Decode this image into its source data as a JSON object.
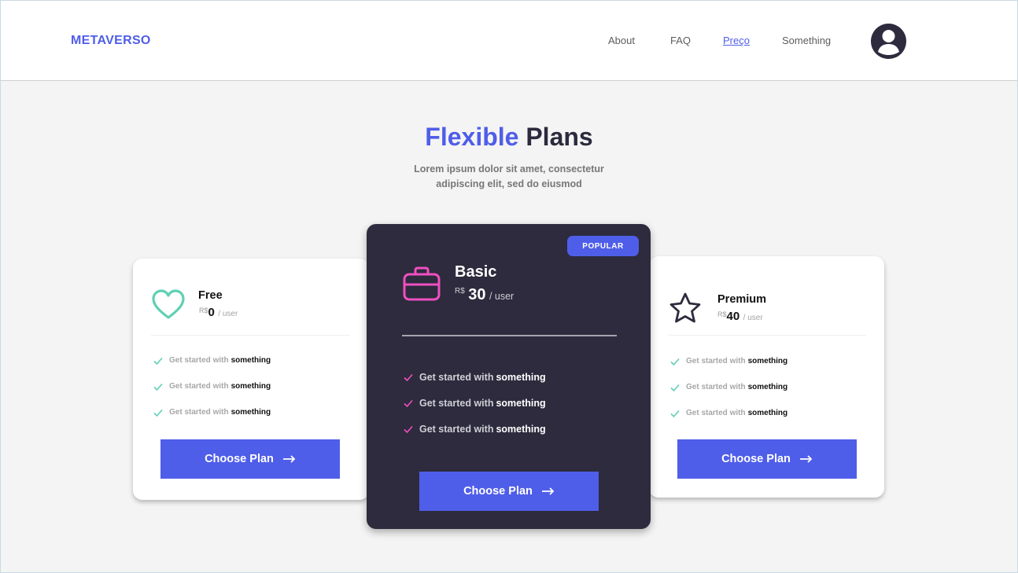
{
  "header": {
    "logo": "METAVERSO",
    "nav": [
      {
        "label": "About",
        "active": false
      },
      {
        "label": "FAQ",
        "active": false
      },
      {
        "label": "Preço",
        "active": true
      },
      {
        "label": "Something",
        "active": false
      }
    ],
    "avatar_icon": "user-icon"
  },
  "hero": {
    "title_accent": "Flexible",
    "title_rest": "Plans",
    "subtitle_line1": "Lorem ipsum dolor sit amet, consectetur",
    "subtitle_line2": "adipiscing elit, sed do eiusmod"
  },
  "plans": [
    {
      "name": "Free",
      "currency": "R$",
      "price": "0",
      "per": "/ user",
      "icon": "heart-icon",
      "features": [
        {
          "text": "Get started with",
          "strong": "something"
        },
        {
          "text": "Get started with",
          "strong": "something"
        },
        {
          "text": "Get started with",
          "strong": "something"
        }
      ],
      "button": "Choose Plan"
    },
    {
      "name": "Basic",
      "badge": "POPULAR",
      "currency": "R$",
      "price": "30",
      "per": "/ user",
      "icon": "briefcase-icon",
      "features": [
        {
          "text": "Get started with",
          "strong": "something"
        },
        {
          "text": "Get started with",
          "strong": "something"
        },
        {
          "text": "Get started with",
          "strong": "something"
        }
      ],
      "button": "Choose Plan"
    },
    {
      "name": "Premium",
      "currency": "R$",
      "price": "40",
      "per": "/ user",
      "icon": "star-icon",
      "features": [
        {
          "text": "Get started with",
          "strong": "something"
        },
        {
          "text": "Get started with",
          "strong": "something"
        },
        {
          "text": "Get started with",
          "strong": "something"
        }
      ],
      "button": "Choose Plan"
    }
  ],
  "colors": {
    "accent": "#4f5ee8",
    "dark": "#2d2b3d",
    "background": "#f4f4f4",
    "free_icon": "#5fd0b4",
    "basic_icon": "#f04fc0",
    "check_free": "#5fd0b4",
    "check_basic": "#f04fc0"
  }
}
